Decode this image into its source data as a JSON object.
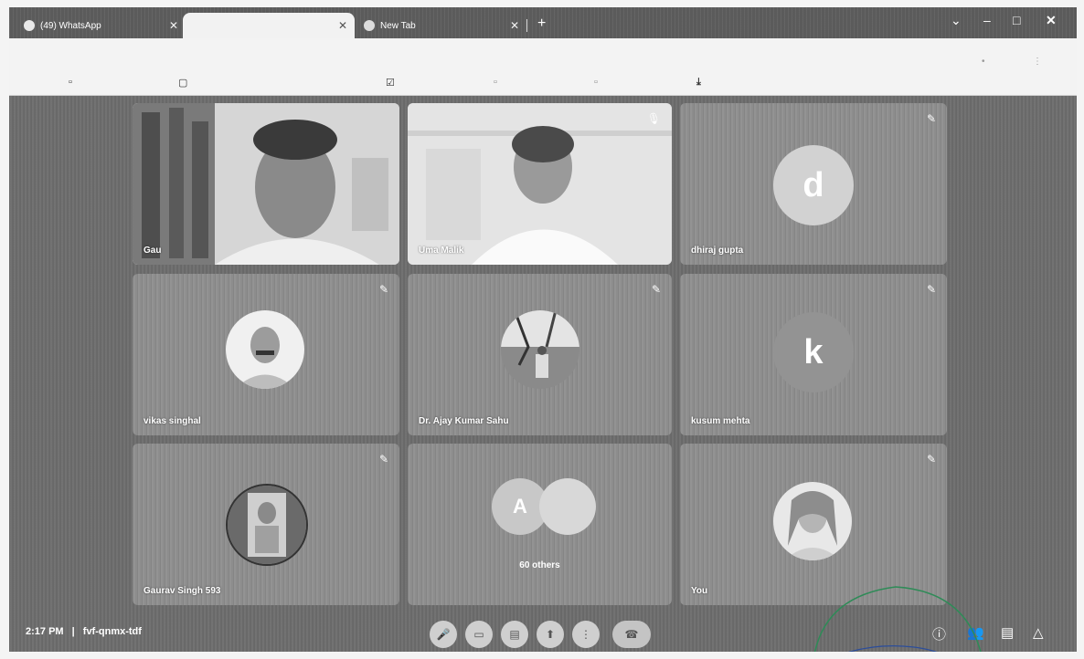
{
  "browser": {
    "tabs": [
      {
        "title": "(49) WhatsApp",
        "active": false
      },
      {
        "title": "",
        "active": true
      },
      {
        "title": "New Tab",
        "active": false
      }
    ]
  },
  "participants": [
    {
      "name": "Gau",
      "type": "video"
    },
    {
      "name": "Uma Malik",
      "type": "video"
    },
    {
      "name": "dhiraj gupta",
      "type": "letter",
      "initial": "d"
    },
    {
      "name": "vikas singhal",
      "type": "photo"
    },
    {
      "name": "Dr. Ajay Kumar Sahu",
      "type": "photo"
    },
    {
      "name": "kusum mehta",
      "type": "letter",
      "initial": "k"
    },
    {
      "name": "Gaurav Singh 593",
      "type": "photo"
    },
    {
      "name": "60 others",
      "type": "group",
      "initial": "A"
    },
    {
      "name": "You",
      "type": "photo"
    }
  ],
  "meeting": {
    "time": "2:17 PM",
    "separator": "|",
    "code": "fvf-qnmx-tdf"
  },
  "colors": {
    "background": "#6e6e6e",
    "tile": "#8d8d8d",
    "annotation_green": "#2e8b57",
    "annotation_blue": "#2b4d9b"
  },
  "icons": {
    "mic": "mic-off-icon",
    "camera": "camera-icon",
    "captions": "captions-icon",
    "present": "present-icon",
    "more": "more-vert-icon",
    "end_call": "end-call-icon",
    "info": "info-icon",
    "people": "people-icon",
    "chat": "chat-icon",
    "activities": "activities-icon"
  }
}
